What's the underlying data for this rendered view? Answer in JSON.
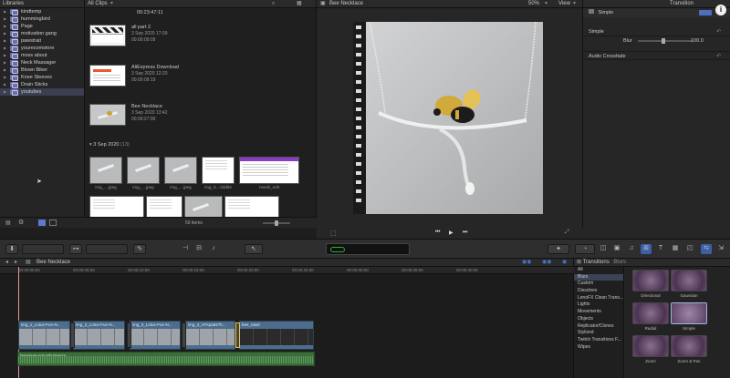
{
  "libraries": {
    "title": "Libraries",
    "items": [
      {
        "label": "kindtemp"
      },
      {
        "label": "hummingbird"
      },
      {
        "label": "Page"
      },
      {
        "label": "motivation gang"
      },
      {
        "label": "pawstrait"
      },
      {
        "label": "yourecomstore"
      },
      {
        "label": "moss about"
      },
      {
        "label": "Neck Massager"
      },
      {
        "label": "Blown Biker"
      },
      {
        "label": "Knee Sleeves"
      },
      {
        "label": "Drain Sticks"
      },
      {
        "label": "youtubes"
      }
    ],
    "selected": "youtubes"
  },
  "browser": {
    "filter": "All Clips",
    "top_time": "00:23:47:11",
    "clips": [
      {
        "name": "all part 2",
        "date": "3 Sep 2020 17:09",
        "duration": "00:00:09:09"
      },
      {
        "name": "AliExpress Download",
        "date": "3 Sep 2020 12:20",
        "duration": "00:00:09:19"
      },
      {
        "name": "Bee Necklace",
        "date": "3 Sep 2020 13:42",
        "duration": "00:00:27:00"
      }
    ],
    "group_label": "3 Sep 2020",
    "group_count": "(13)",
    "grid_labels": [
      "img_....jpeg",
      "img_....jpeg",
      "img_....jpeg",
      "img_3....03d92",
      "needs_edit"
    ],
    "item_count": "59 items"
  },
  "viewer": {
    "title": "Bee Necklace",
    "zoom": "50%",
    "view_label": "View"
  },
  "inspector": {
    "tab": "Transition",
    "name": "Simple",
    "section": "Simple",
    "blur_label": "Blur",
    "blur_value": "100.0",
    "audio_section": "Audio Crossfade"
  },
  "timeline": {
    "project": "Bee Necklace",
    "timecodes": [
      "00:00:00:00",
      "00:00:05:00",
      "00:00:10:00",
      "00:00:15:00",
      "00:00:20:00",
      "00:00:25:00",
      "00:00:30:00",
      "00:00:35:00",
      "00:00:40:00"
    ],
    "clips": [
      {
        "label": "img_1_Lotus-Fun-N..."
      },
      {
        "label": "img_2_Lotus-Fun-N..."
      },
      {
        "label": "img_3_Lotus-Fun-N..."
      },
      {
        "label": "img_3_H7spa847b..."
      },
      {
        "label": "bee_ntwd"
      }
    ],
    "audio_label": "beneaver-smooth-breeze"
  },
  "transitions": {
    "title": "Transitions",
    "filter": "Blurs",
    "categories": [
      "All",
      "Blurs",
      "Custom",
      "Dissolves",
      "LenoFX Clean Trans...",
      "Lights",
      "Movements",
      "Objects",
      "Replicator/Clones",
      "Stylized",
      "Twitch Transitions F...",
      "Wipes"
    ],
    "selected_category": "Blurs",
    "items": [
      {
        "label": "Directional"
      },
      {
        "label": "Gaussian"
      },
      {
        "label": "Radial"
      },
      {
        "label": "Simple"
      },
      {
        "label": "Zoom"
      },
      {
        "label": "Zoom & Pan"
      }
    ],
    "selected_item": "Simple"
  },
  "colors": {
    "accent": "#6b6fa8",
    "video_clip": "#4c6d8d",
    "audio_clip": "#3a6d3a",
    "selection": "#3b4357"
  }
}
